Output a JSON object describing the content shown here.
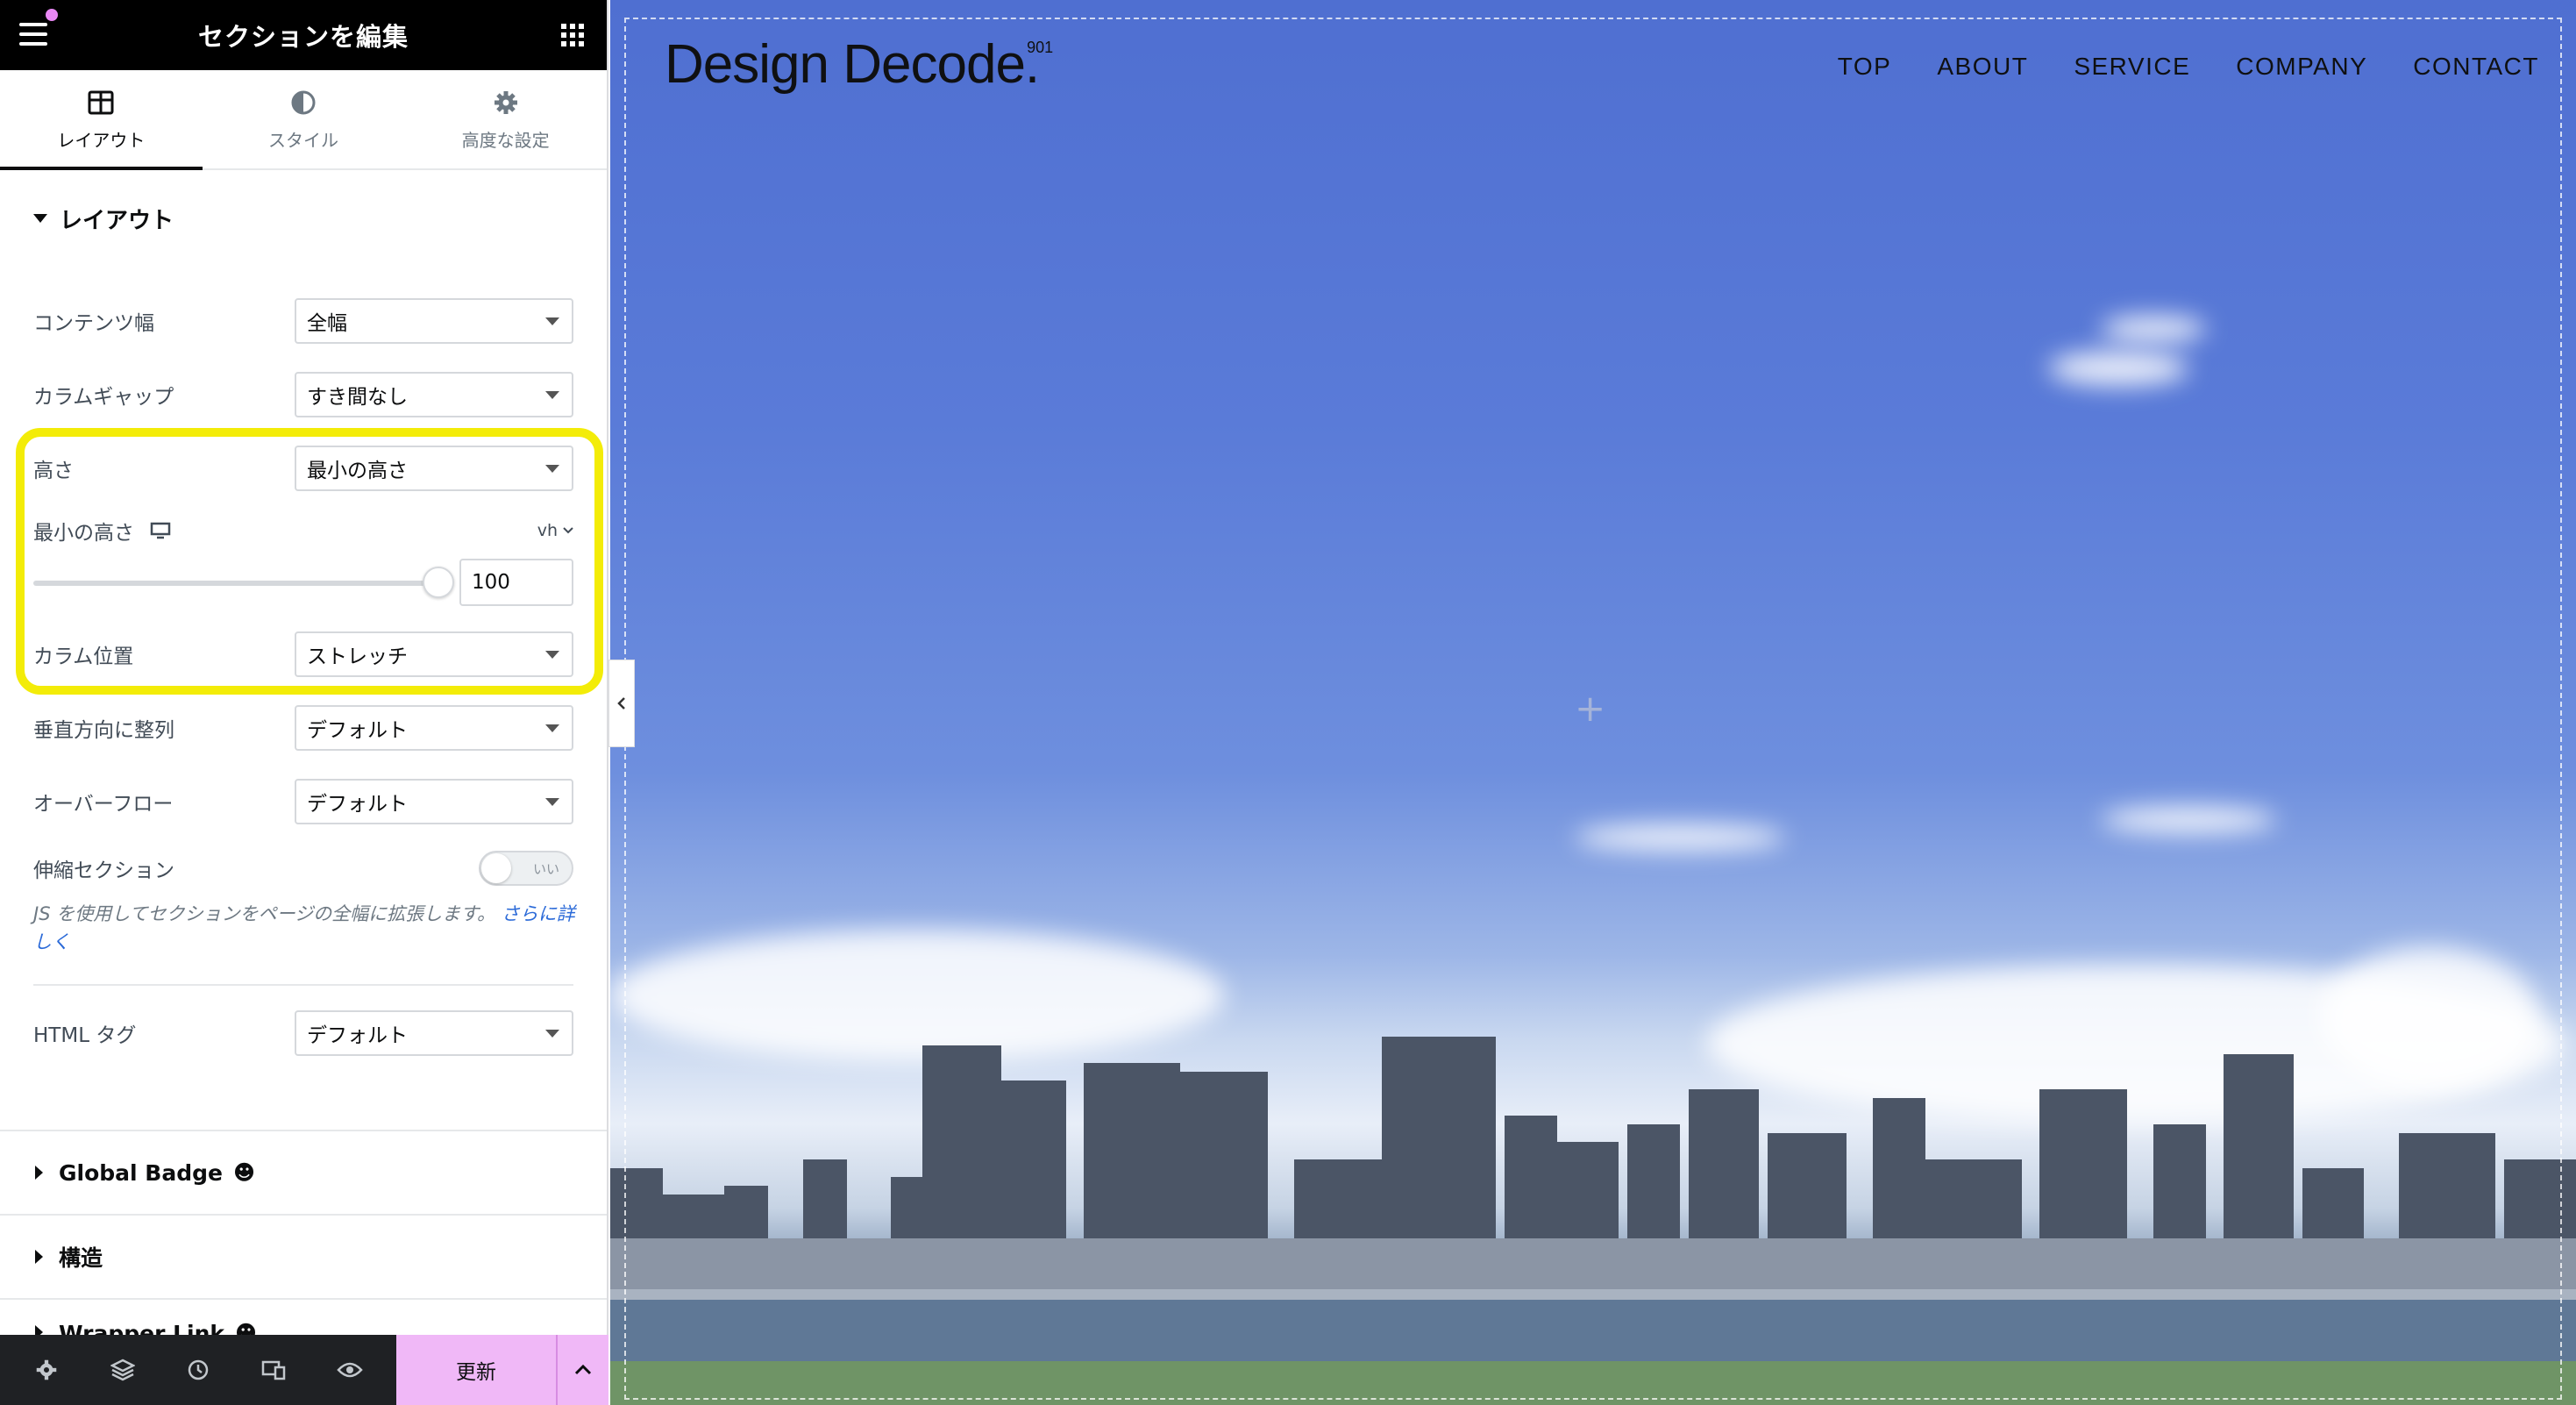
{
  "editor": {
    "title": "セクションを編集",
    "tabs": [
      {
        "label": "レイアウト",
        "icon": "columns-icon"
      },
      {
        "label": "スタイル",
        "icon": "half-circle-icon"
      },
      {
        "label": "高度な設定",
        "icon": "gear-icon"
      }
    ],
    "section_title": "レイアウト",
    "fields": {
      "content_width": {
        "label": "コンテンツ幅",
        "value": "全幅"
      },
      "column_gap": {
        "label": "カラムギャップ",
        "value": "すき間なし"
      },
      "height": {
        "label": "高さ",
        "value": "最小の高さ"
      },
      "min_height": {
        "label": "最小の高さ",
        "unit": "vh",
        "value": "100",
        "slider_fraction": 1.0
      },
      "column_position": {
        "label": "カラム位置",
        "value": "ストレッチ"
      },
      "vertical_align": {
        "label": "垂直方向に整列",
        "value": "デフォルト"
      },
      "overflow": {
        "label": "オーバーフロー",
        "value": "デフォルト"
      },
      "stretch_section": {
        "label": "伸縮セクション",
        "toggle_text": "いい"
      },
      "stretch_note": "JS を使用してセクションをページの全幅に拡張します。",
      "stretch_note_link": "さらに詳しく",
      "html_tag": {
        "label": "HTML タグ",
        "value": "デフォルト"
      }
    },
    "accordions": [
      {
        "label": "Global Badge",
        "emoji": "☻"
      },
      {
        "label": "構造"
      },
      {
        "label": "Wrapper Link",
        "emoji": "☻"
      }
    ],
    "bottom": {
      "update_label": "更新"
    },
    "colors": {
      "highlight": "#f3ec08",
      "update_bg": "#f0b8f7",
      "topbar": "#000000"
    }
  },
  "preview": {
    "logo": "Design Decode.",
    "logo_sup": "901",
    "nav": [
      "TOP",
      "ABOUT",
      "SERVICE",
      "COMPANY",
      "CONTACT"
    ],
    "add_symbol": "+"
  }
}
